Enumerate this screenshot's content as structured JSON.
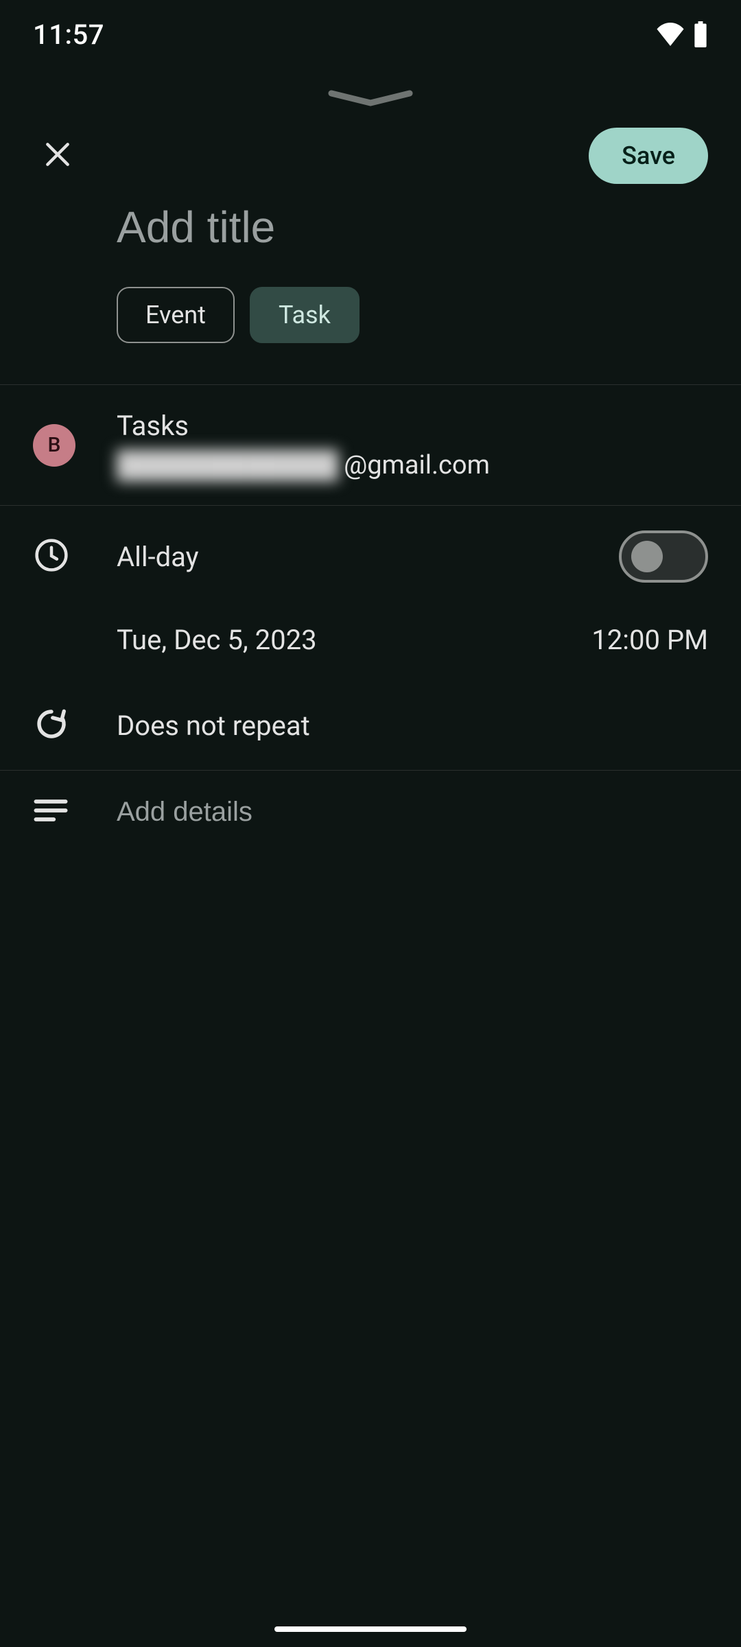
{
  "statusbar": {
    "time": "11:57"
  },
  "appbar": {
    "save_label": "Save"
  },
  "title": {
    "placeholder": "Add title",
    "value": ""
  },
  "chips": {
    "event_label": "Event",
    "task_label": "Task",
    "selected": "Task"
  },
  "account": {
    "list_name": "Tasks",
    "avatar_initial": "B",
    "email_prefix_obscured": "████████████",
    "email_domain": "@gmail.com"
  },
  "time_section": {
    "allday_label": "All-day",
    "allday_on": false,
    "date": "Tue, Dec 5, 2023",
    "time": "12:00 PM",
    "repeat_label": "Does not repeat"
  },
  "details": {
    "placeholder": "Add details",
    "value": ""
  },
  "colors": {
    "accent": "#9fd4c8",
    "chip_selected_bg": "#324b45",
    "avatar_bg": "#c67d87"
  },
  "icons": {
    "close": "close-icon",
    "handle": "collapse-handle-icon",
    "wifi": "wifi-icon",
    "battery": "battery-icon",
    "clock": "clock-icon",
    "repeat": "repeat-icon",
    "notes": "notes-icon"
  }
}
